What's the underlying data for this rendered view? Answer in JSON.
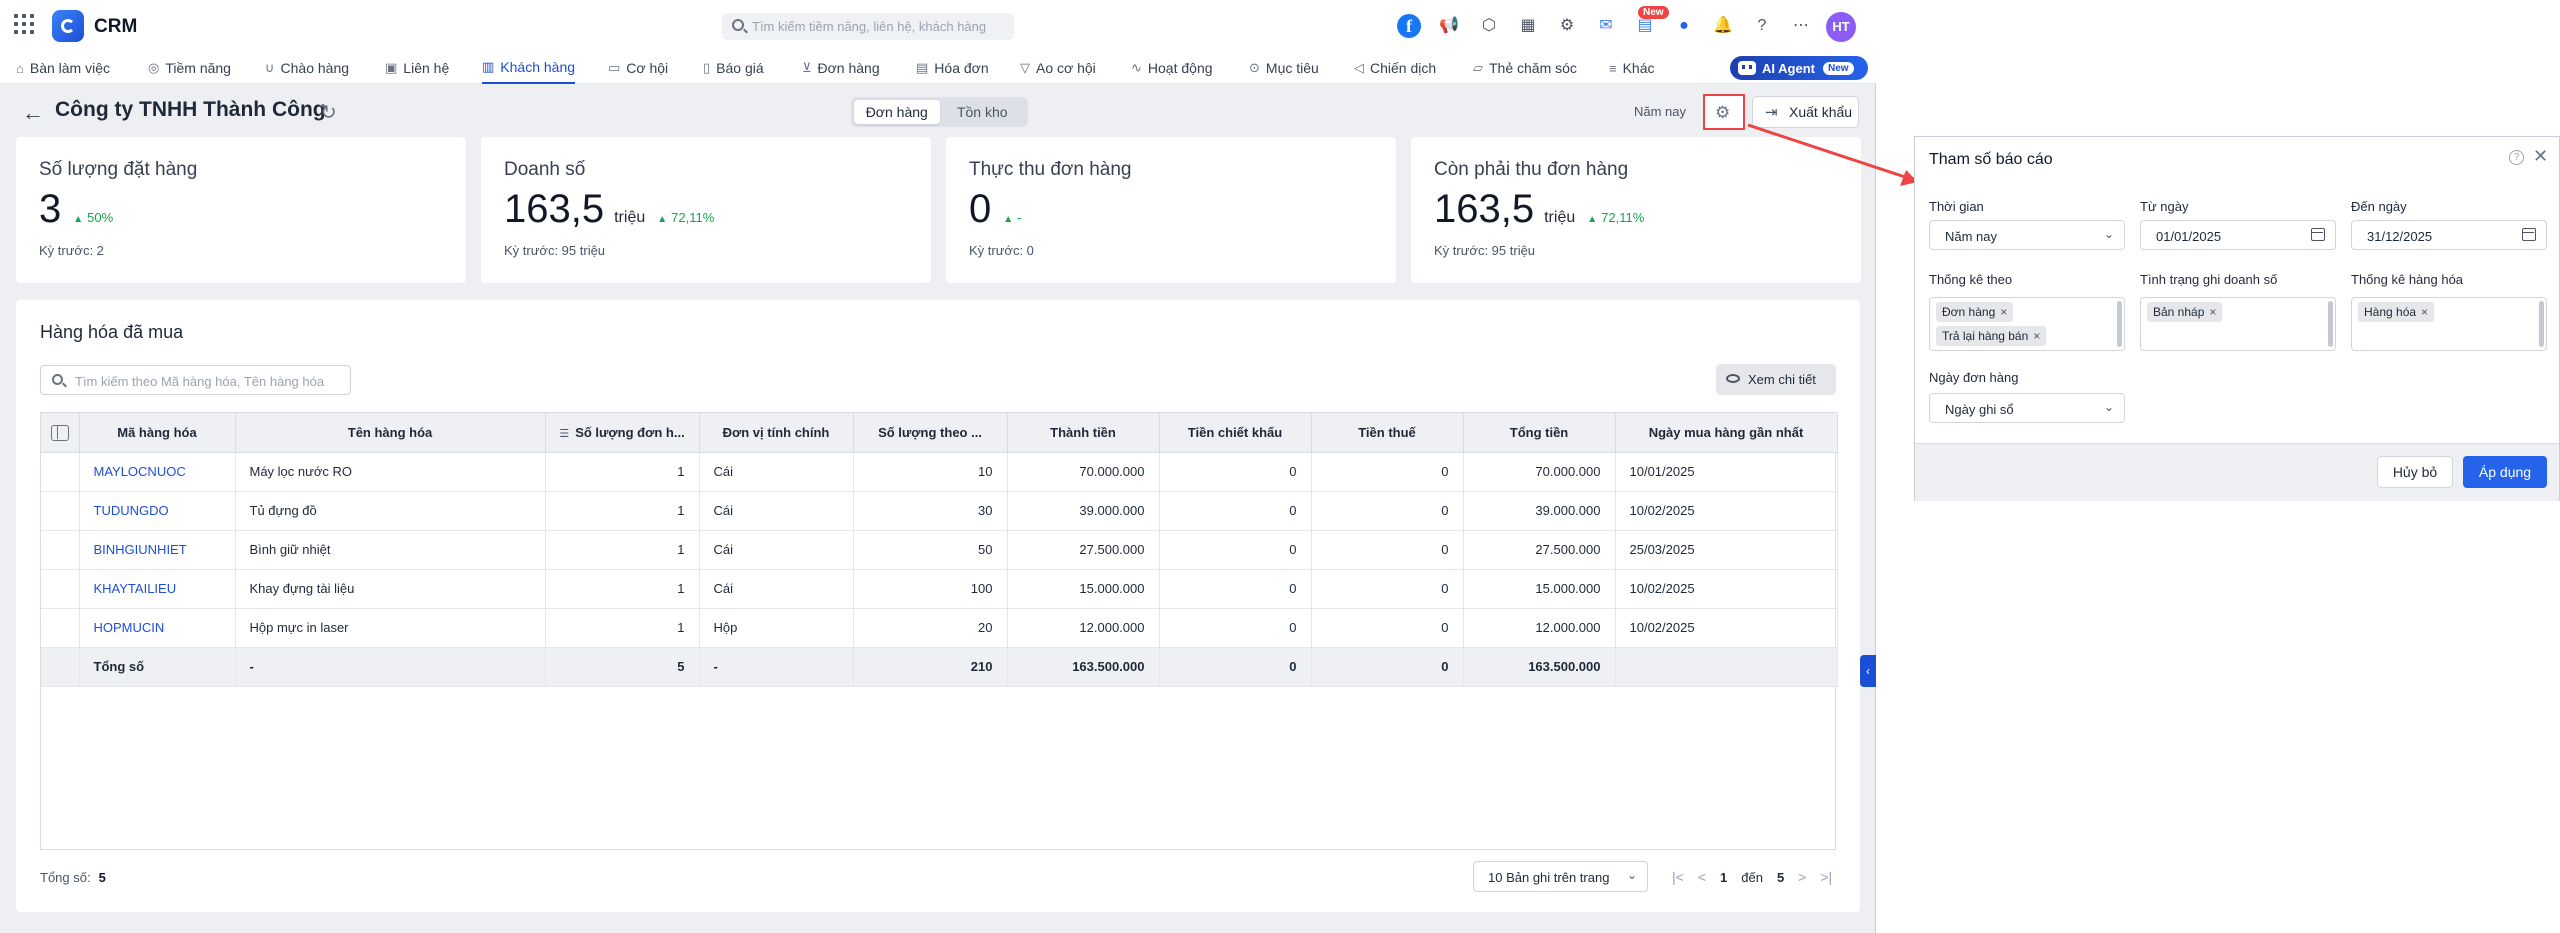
{
  "app": {
    "name": "CRM",
    "avatar_initials": "HT",
    "new_badge": "New"
  },
  "search": {
    "placeholder": "Tìm kiếm tiềm năng, liên hệ, khách hàng"
  },
  "nav": {
    "items": [
      {
        "label": "Bàn làm việc",
        "icon": "home-icon"
      },
      {
        "label": "Tiềm năng",
        "icon": "user-circle-icon"
      },
      {
        "label": "Chào hàng",
        "icon": "magnet-icon"
      },
      {
        "label": "Liên hệ",
        "icon": "contact-icon"
      },
      {
        "label": "Khách hàng",
        "icon": "building-icon"
      },
      {
        "label": "Cơ hội",
        "icon": "briefcase-icon"
      },
      {
        "label": "Báo giá",
        "icon": "quote-icon"
      },
      {
        "label": "Đơn hàng",
        "icon": "cart-icon"
      },
      {
        "label": "Hóa đơn",
        "icon": "invoice-icon"
      },
      {
        "label": "Ao cơ hội",
        "icon": "funnel-icon"
      },
      {
        "label": "Hoạt động",
        "icon": "activity-icon"
      },
      {
        "label": "Mục tiêu",
        "icon": "target-icon"
      },
      {
        "label": "Chiến dịch",
        "icon": "megaphone-icon"
      },
      {
        "label": "Thẻ chăm sóc",
        "icon": "card-icon"
      },
      {
        "label": "Khác",
        "icon": "menu-icon"
      }
    ],
    "active_index": 4,
    "ai_agent": {
      "label": "AI Agent",
      "badge": "New"
    }
  },
  "page": {
    "title": "Công ty TNHH Thành Công",
    "tabs": [
      "Đơn hàng",
      "Tồn kho"
    ],
    "period": "Năm nay",
    "export_label": "Xuất khẩu"
  },
  "kpis": [
    {
      "label": "Số lượng đặt hàng",
      "value": "3",
      "unit": "",
      "delta": "50%",
      "prev": "Kỳ trước: 2"
    },
    {
      "label": "Doanh số",
      "value": "163,5",
      "unit": "triệu",
      "delta": "72,11%",
      "prev": "Kỳ trước: 95 triệu"
    },
    {
      "label": "Thực thu đơn hàng",
      "value": "0",
      "unit": "",
      "delta": "-",
      "prev": "Kỳ trước: 0"
    },
    {
      "label": "Còn phải thu đơn hàng",
      "value": "163,5",
      "unit": "triệu",
      "delta": "72,11%",
      "prev": "Kỳ trước: 95 triệu"
    }
  ],
  "goods": {
    "title": "Hàng hóa đã mua",
    "search_placeholder": "Tìm kiếm theo Mã hàng hóa, Tên hàng hóa",
    "detail_label": "Xem chi tiết",
    "columns": [
      "Mã hàng hóa",
      "Tên hàng hóa",
      "Số lượng đơn h...",
      "Đơn vị tính chính",
      "Số lượng theo ...",
      "Thành tiền",
      "Tiền chiết khấu",
      "Tiền thuế",
      "Tổng tiền",
      "Ngày mua hàng gần nhất"
    ],
    "rows": [
      [
        "MAYLOCNUOC",
        "Máy lọc nước RO",
        "1",
        "Cái",
        "10",
        "70.000.000",
        "0",
        "0",
        "70.000.000",
        "10/01/2025"
      ],
      [
        "TUDUNGDO",
        "Tủ đựng đồ",
        "1",
        "Cái",
        "30",
        "39.000.000",
        "0",
        "0",
        "39.000.000",
        "10/02/2025"
      ],
      [
        "BINHGIUNHIET",
        "Bình giữ nhiệt",
        "1",
        "Cái",
        "50",
        "27.500.000",
        "0",
        "0",
        "27.500.000",
        "25/03/2025"
      ],
      [
        "KHAYTAILIEU",
        "Khay đựng tài liệu",
        "1",
        "Cái",
        "100",
        "15.000.000",
        "0",
        "0",
        "15.000.000",
        "10/02/2025"
      ],
      [
        "HOPMUCIN",
        "Hộp mực in laser",
        "1",
        "Hộp",
        "20",
        "12.000.000",
        "0",
        "0",
        "12.000.000",
        "10/02/2025"
      ]
    ],
    "total": [
      "Tổng số",
      "-",
      "5",
      "-",
      "210",
      "163.500.000",
      "0",
      "0",
      "163.500.000",
      ""
    ],
    "footer_total_label": "Tổng số:",
    "footer_total_value": "5",
    "page_size": "10 Bản ghi trên trang",
    "pager_from": "1",
    "pager_to_label": "đến",
    "pager_to": "5"
  },
  "dialog": {
    "title": "Tham số báo cáo",
    "time_label": "Thời gian",
    "time_value": "Năm nay",
    "from_label": "Từ ngày",
    "from_value": "01/01/2025",
    "to_label": "Đến ngày",
    "to_value": "31/12/2025",
    "stat_by_label": "Thống kê theo",
    "stat_by_tags": [
      "Đơn hàng",
      "Trả lại hàng bán"
    ],
    "revenue_status_label": "Tình trạng ghi doanh số",
    "revenue_status_tags": [
      "Bản nháp"
    ],
    "goods_stat_label": "Thống kê hàng hóa",
    "goods_stat_tags": [
      "Hàng hóa"
    ],
    "order_date_label": "Ngày đơn hàng",
    "order_date_value": "Ngày ghi sổ",
    "cancel_label": "Hủy bỏ",
    "apply_label": "Áp dụng"
  },
  "colors": {
    "accent": "#1d4ed8",
    "positive": "#16a34a",
    "highlight": "#ef4444"
  }
}
